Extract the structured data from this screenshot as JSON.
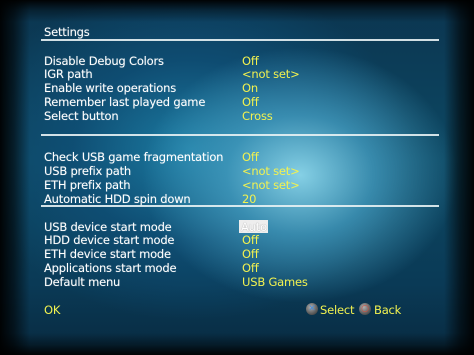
{
  "title": "Settings",
  "section1": [
    {
      "label": "Disable Debug Colors",
      "value": "Off"
    },
    {
      "label": "IGR path",
      "value": "<not set>"
    },
    {
      "label": "Enable write operations",
      "value": "On"
    },
    {
      "label": "Remember last played game",
      "value": "Off"
    },
    {
      "label": "Select button",
      "value": "Cross"
    }
  ],
  "section2": [
    {
      "label": "Check USB game fragmentation",
      "value": "Off"
    },
    {
      "label": "USB prefix path",
      "value": "<not set>"
    },
    {
      "label": "ETH prefix path",
      "value": "<not set>"
    },
    {
      "label": "Automatic HDD spin down",
      "value": "20"
    }
  ],
  "section3": [
    {
      "label": "USB device start mode",
      "value": "Auto",
      "selected": true
    },
    {
      "label": "HDD device start mode",
      "value": "Off"
    },
    {
      "label": "ETH device start mode",
      "value": "Off"
    },
    {
      "label": "Applications start mode",
      "value": "Off"
    },
    {
      "label": "Default menu",
      "value": "USB Games"
    }
  ],
  "footer": {
    "ok_label": "OK",
    "select_label": "Select",
    "back_label": "Back",
    "select_icon": "cross-button-icon",
    "back_icon": "circle-button-icon"
  },
  "colors": {
    "label": "#ffffff",
    "value": "#f2f250",
    "selected_bg": "#eeeeee",
    "select_icon_mark": "#4a8ed8",
    "back_icon_mark": "#d84a3a"
  }
}
